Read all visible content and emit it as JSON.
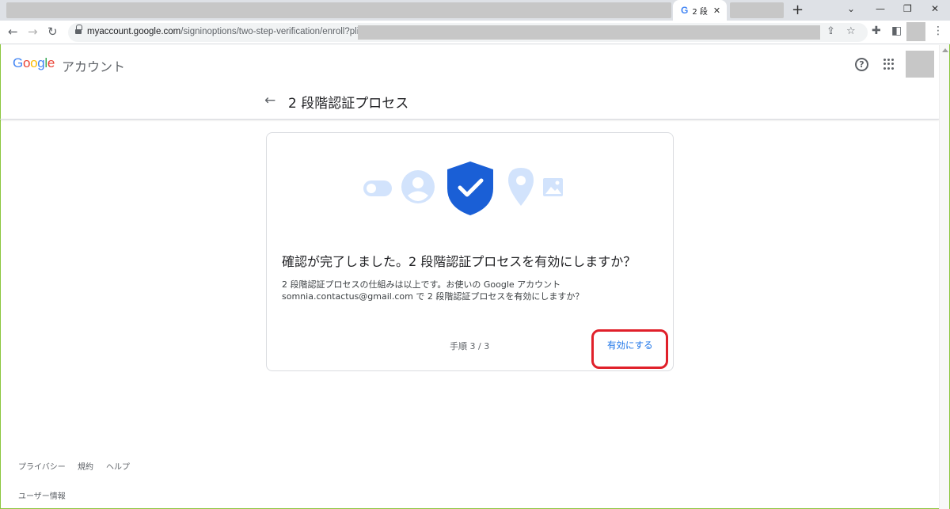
{
  "browser": {
    "active_tab_title": "2 段",
    "url_domain": "myaccount.google.com",
    "url_path": "/signinoptions/two-step-verification/enroll?pli="
  },
  "header": {
    "logo_text": "Google",
    "logo_suffix": "アカウント",
    "page_title": "2 段階認証プロセス"
  },
  "card": {
    "heading": "確認が完了しました。2 段階認証プロセスを有効にしますか？",
    "description_line1": "2 段階認証プロセスの仕組みは以上です。お使いの Google アカウント",
    "description_line2": "somnia.contactus@gmail.com で 2 段階認証プロセスを有効にしますか？",
    "step": "手順 3 / 3",
    "enable_label": "有効にする"
  },
  "footer": {
    "privacy": "プライバシー",
    "terms": "規約",
    "help": "ヘルプ",
    "user_info": "ユーザー情報"
  },
  "colors": {
    "accent_blue": "#1a73e8",
    "shield_blue": "#1a5fd6",
    "light_icon_blue": "#d2e3fc",
    "highlight_red": "#e0202a"
  },
  "icons": [
    "back-arrow-icon",
    "help-icon",
    "apps-icon",
    "shield-check-icon",
    "toggle-icon",
    "person-icon",
    "location-pin-icon",
    "image-icon"
  ]
}
